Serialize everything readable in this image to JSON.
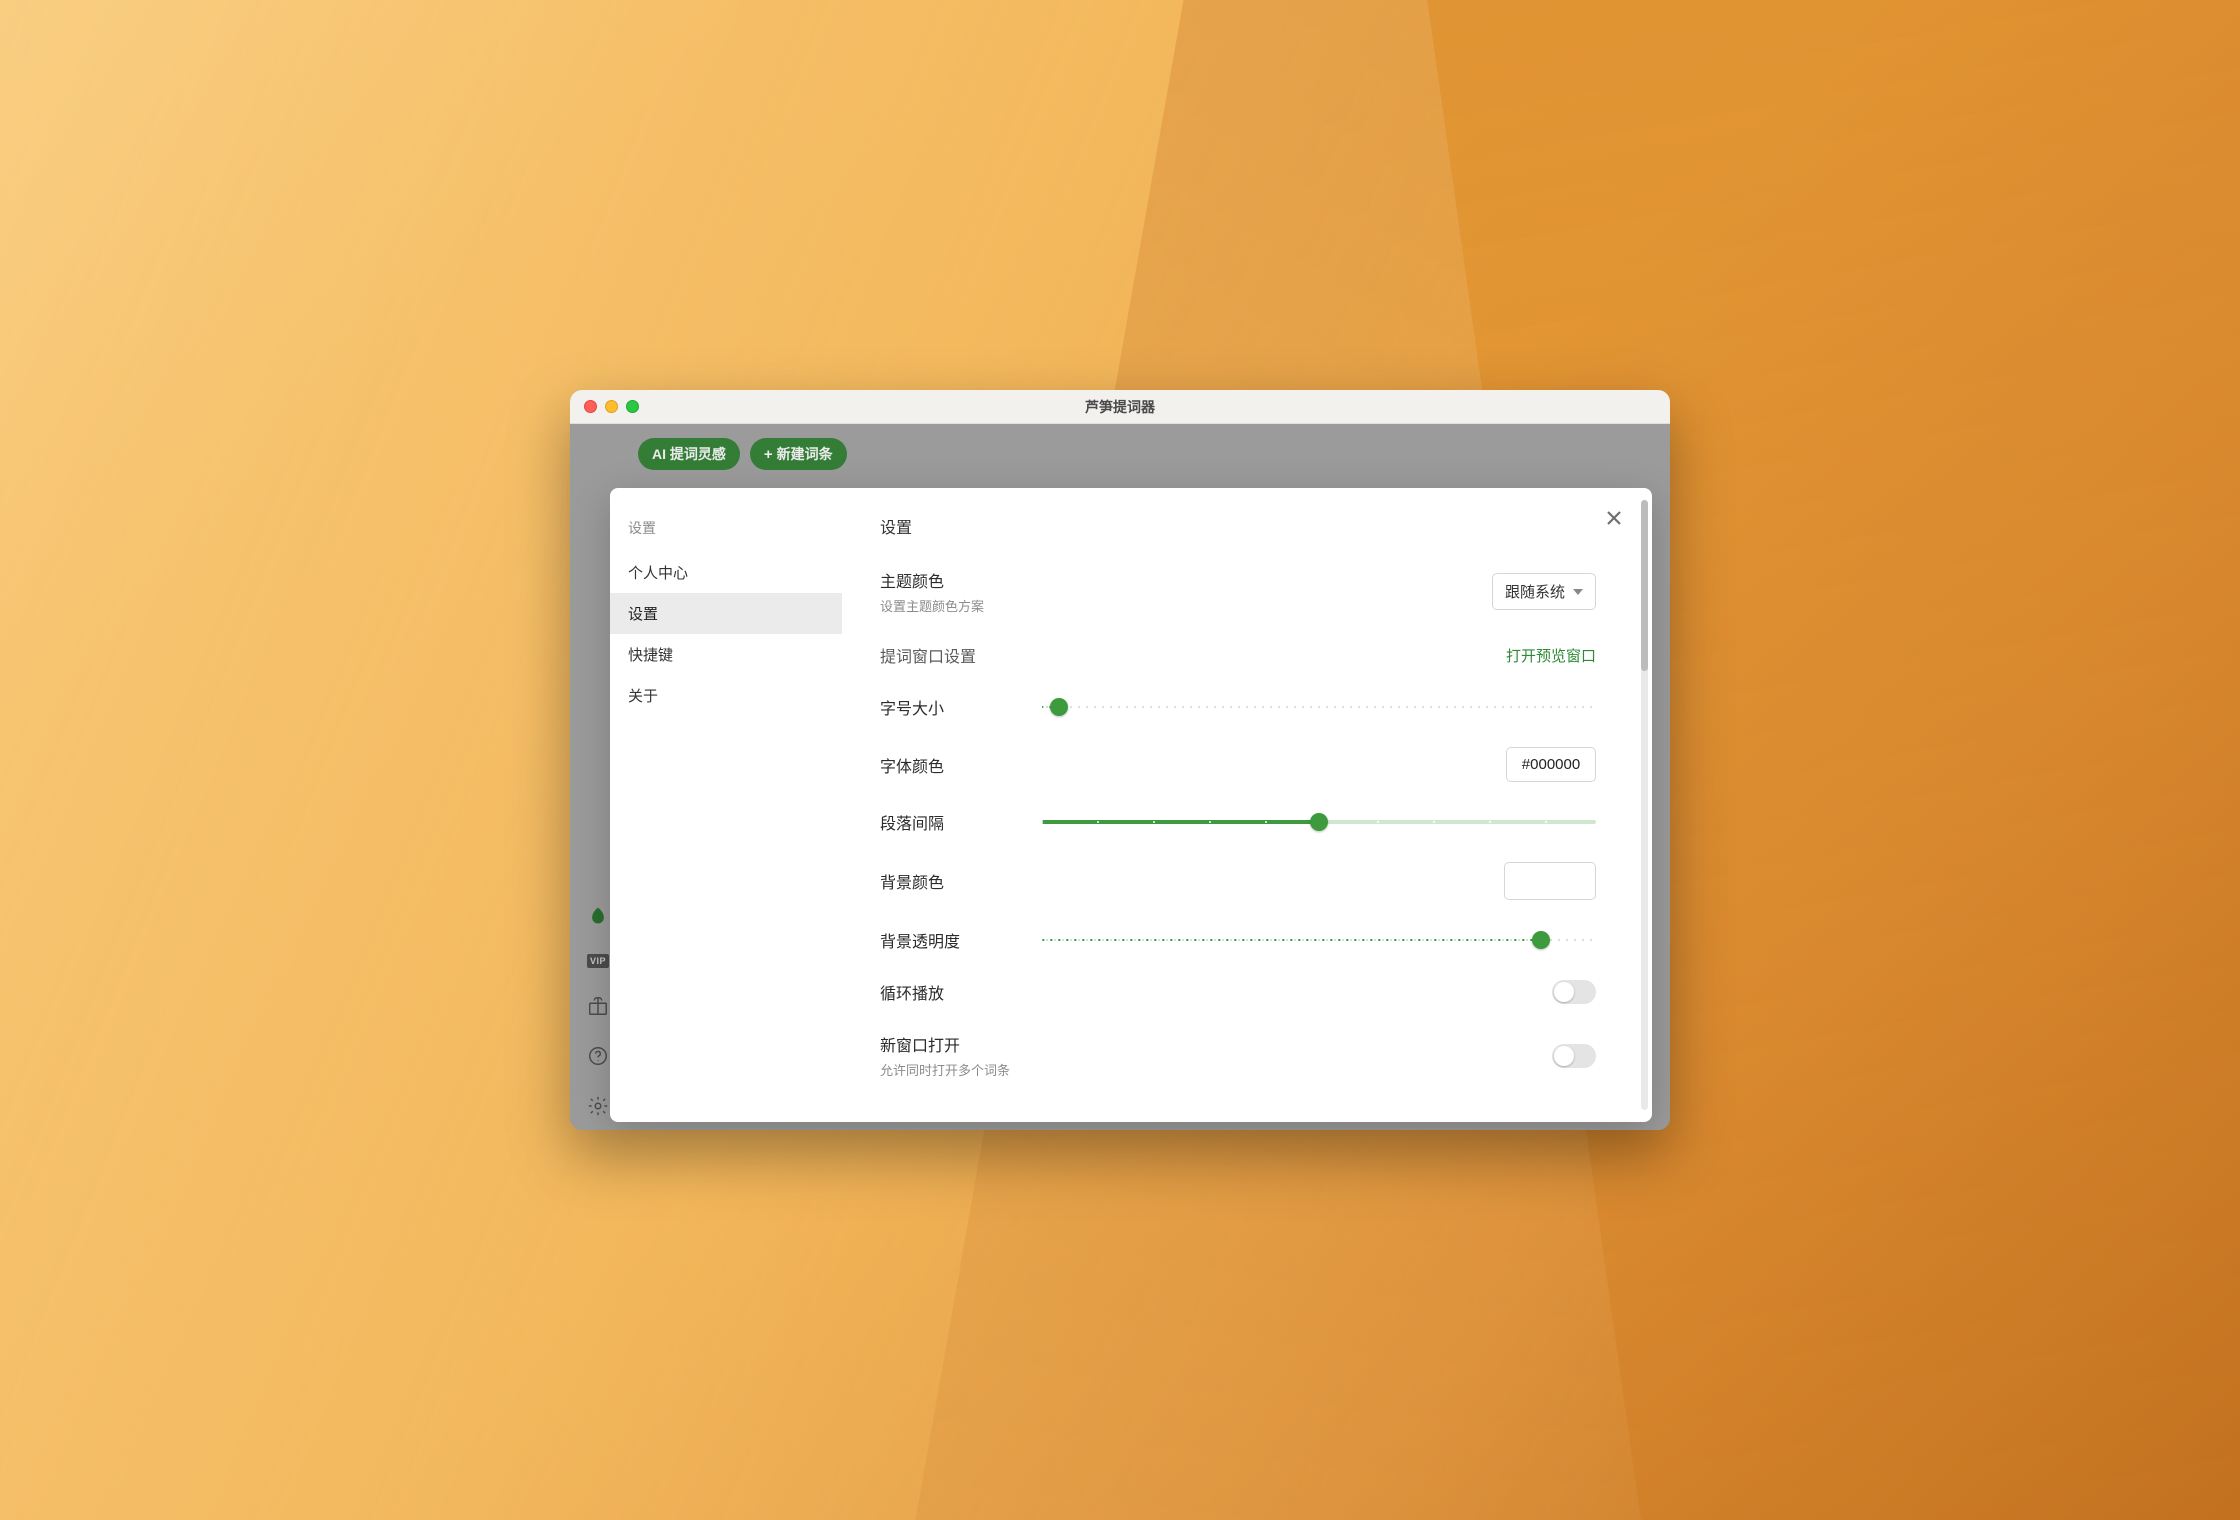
{
  "window": {
    "title": "芦笋提词器"
  },
  "app": {
    "pill_ai": "AI 提词灵感",
    "pill_new": "新建词条",
    "plus": "+",
    "vip_label": "VIP"
  },
  "modal": {
    "side_title": "设置",
    "side_items": [
      "个人中心",
      "设置",
      "快捷键",
      "关于"
    ],
    "side_active_index": 1,
    "main_title": "设置",
    "theme": {
      "label": "主题颜色",
      "sublabel": "设置主题颜色方案",
      "value": "跟随系统"
    },
    "preview_section_label": "提词窗口设置",
    "preview_link": "打开预览窗口",
    "font_size": {
      "label": "字号大小",
      "percent": 3
    },
    "font_color": {
      "label": "字体颜色",
      "value": "#000000"
    },
    "paragraph_gap": {
      "label": "段落间隔",
      "percent": 50
    },
    "bg_color": {
      "label": "背景颜色",
      "value": ""
    },
    "bg_opacity": {
      "label": "背景透明度",
      "percent": 90
    },
    "loop": {
      "label": "循环播放",
      "on": false
    },
    "new_window": {
      "label": "新窗口打开",
      "sublabel": "允许同时打开多个词条",
      "on": false
    }
  },
  "colors": {
    "accent": "#3d9a3d"
  }
}
